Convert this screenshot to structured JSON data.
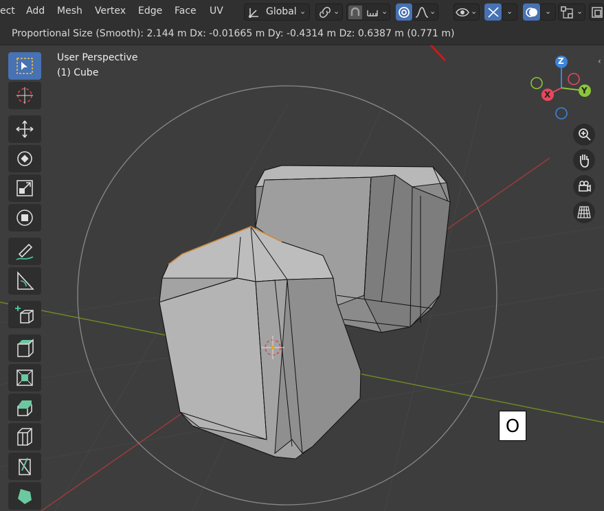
{
  "menu": {
    "items": [
      "ect",
      "Add",
      "Mesh",
      "Vertex",
      "Edge",
      "Face",
      "UV"
    ]
  },
  "header": {
    "orientation_label": "Global",
    "orientation_icon": "transform-orientation-icon",
    "pivot_icon": "link-icon",
    "snap_icon": "snap-magnet-icon",
    "snap_target_icon": "snap-increment-icon",
    "proportional_icon": "proportional-editing-icon",
    "falloff_icon": "falloff-smooth-icon",
    "overlay_icon": "eye-visibility-icon",
    "gizmo_icon": "gizmo-icon",
    "shading_icon": "overlay-icon",
    "xray_icon": "xray-icon"
  },
  "operator_bar": {
    "text": "Proportional Size (Smooth): 2.144 m   Dx: -0.01665 m   Dy: -0.4314 m   Dz: 0.6387 m (0.771 m)"
  },
  "viewport": {
    "view_name": "User Perspective",
    "object_name": "(1) Cube",
    "key_pressed": "O"
  },
  "toolbar": {
    "tools": [
      {
        "name": "select-box-tool",
        "icon": "select-box-icon",
        "active": true
      },
      {
        "name": "cursor-tool",
        "icon": "cursor-icon"
      },
      {
        "name": "move-tool",
        "icon": "move-icon"
      },
      {
        "name": "rotate-tool",
        "icon": "rotate-icon"
      },
      {
        "name": "scale-tool",
        "icon": "scale-icon"
      },
      {
        "name": "transform-tool",
        "icon": "transform-icon"
      },
      {
        "name": "annotate-tool",
        "icon": "annotate-icon"
      },
      {
        "name": "measure-tool",
        "icon": "measure-icon"
      },
      {
        "name": "add-cube-tool",
        "icon": "add-cube-icon"
      },
      {
        "name": "extrude-tool",
        "icon": "extrude-icon"
      },
      {
        "name": "inset-tool",
        "icon": "inset-icon"
      },
      {
        "name": "bevel-tool",
        "icon": "bevel-icon"
      },
      {
        "name": "loop-cut-tool",
        "icon": "loop-cut-icon"
      },
      {
        "name": "knife-tool",
        "icon": "knife-icon"
      },
      {
        "name": "poly-build-tool",
        "icon": "poly-build-icon"
      }
    ]
  },
  "gizmo": {
    "x_label": "X",
    "y_label": "Y",
    "z_label": "Z",
    "colors": {
      "x": "#e8475a",
      "y": "#8cc43c",
      "z": "#3c84dc"
    }
  },
  "nav_buttons": [
    "zoom-icon",
    "pan-hand-icon",
    "camera-icon",
    "grid-perspective-icon"
  ],
  "colors": {
    "accent": "#4772b3",
    "background": "#3d3d3d",
    "x_axis": "#b03a3a",
    "y_axis": "#7a9a2a"
  }
}
